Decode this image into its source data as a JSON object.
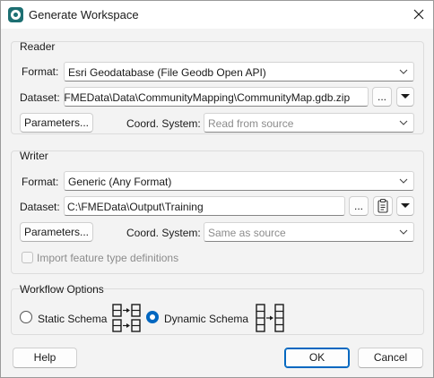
{
  "window": {
    "title": "Generate Workspace",
    "close_icon": "close-icon",
    "app_icon": "fme-workbench-icon"
  },
  "reader": {
    "group_title": "Reader",
    "format_label": "Format:",
    "format_value": "Esri Geodatabase (File Geodb Open API)",
    "dataset_label": "Dataset:",
    "dataset_value": "\\FMEData\\Data\\CommunityMapping\\CommunityMap.gdb.zip",
    "browse_label": "...",
    "parameters_label": "Parameters...",
    "coord_label": "Coord. System:",
    "coord_placeholder": "Read from source"
  },
  "writer": {
    "group_title": "Writer",
    "format_label": "Format:",
    "format_value": "Generic (Any Format)",
    "dataset_label": "Dataset:",
    "dataset_value": "C:\\FMEData\\Output\\Training",
    "browse_label": "...",
    "parameters_label": "Parameters...",
    "coord_label": "Coord. System:",
    "coord_placeholder": "Same as source",
    "import_feature_types_label": "Import feature type definitions",
    "import_feature_types_checked": false
  },
  "workflow": {
    "group_title": "Workflow Options",
    "static_label": "Static Schema",
    "dynamic_label": "Dynamic Schema",
    "selected": "Dynamic Schema"
  },
  "footer": {
    "help_label": "Help",
    "ok_label": "OK",
    "cancel_label": "Cancel"
  },
  "colors": {
    "accent": "#0067c0",
    "dialog_background": "#f3f3f3",
    "app_icon": "#1d6f72"
  }
}
